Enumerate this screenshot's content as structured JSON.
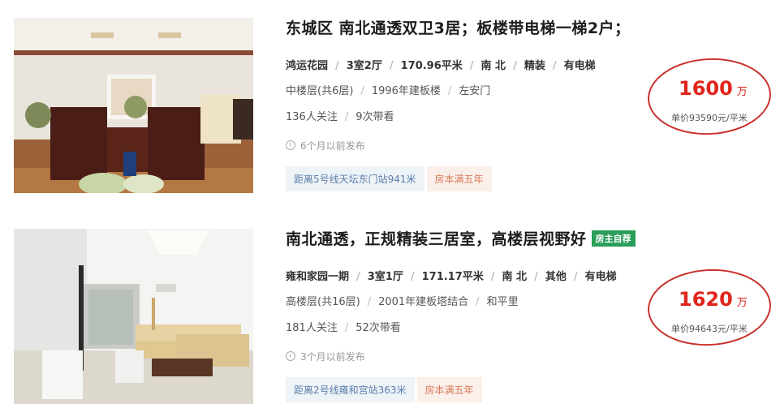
{
  "listings": [
    {
      "title": "东城区 南北通透双卫3居；板楼带电梯一梯2户；",
      "owner_tag": "",
      "community": "鸿运花园",
      "layout": "3室2厅",
      "area": "170.96平米",
      "orientation": "南 北",
      "decoration": "精装",
      "elevator": "有电梯",
      "floor": "中楼层(共6层)",
      "build": "1996年建板楼",
      "district": "左安门",
      "followers": "136人关注",
      "viewings": "9次带看",
      "published": "6个月以前发布",
      "subway_tag": "距离5号线天坛东门站941米",
      "tax_tag": "房本满五年",
      "price": "1600",
      "price_unit": "万",
      "unit_price": "单价93590元/平米"
    },
    {
      "title": "南北通透，正规精装三居室，高楼层视野好",
      "owner_tag": "房主自荐",
      "community": "雍和家园一期",
      "layout": "3室1厅",
      "area": "171.17平米",
      "orientation": "南 北",
      "decoration": "其他",
      "elevator": "有电梯",
      "floor": "高楼层(共16层)",
      "build": "2001年建板塔结合",
      "district": "和平里",
      "followers": "181人关注",
      "viewings": "52次带看",
      "published": "3个月以前发布",
      "subway_tag": "距离2号线雍和宫站363米",
      "tax_tag": "房本满五年",
      "price": "1620",
      "price_unit": "万",
      "unit_price": "单价94643元/平米"
    }
  ],
  "colors": {
    "price_red": "#e1251b",
    "circle_red": "#c9302c",
    "owner_tag_green": "#2a9e59",
    "subway_tag_bg": "#eef3f8",
    "tax_tag_bg": "#fbefe9"
  }
}
